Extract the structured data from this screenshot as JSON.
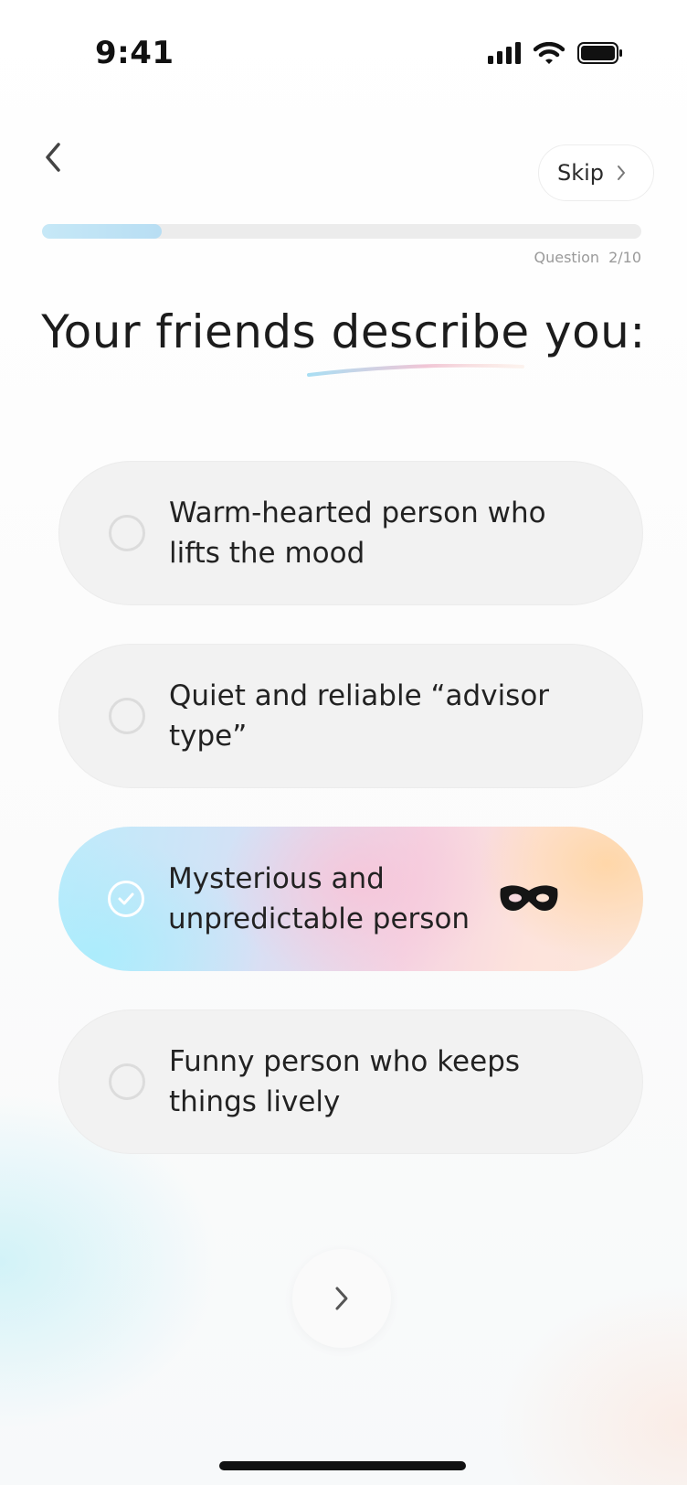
{
  "status_bar": {
    "time": "9:41",
    "icons": [
      "signal-icon",
      "wifi-icon",
      "battery-icon"
    ]
  },
  "header": {
    "back_icon": "chevron-left-icon",
    "skip_label": "Skip",
    "skip_icon": "chevron-right-icon"
  },
  "progress": {
    "label": "Question",
    "count": "2/10",
    "fraction": 0.2
  },
  "title": "Your friends describe you:",
  "options": [
    {
      "label": "Warm-hearted person who lifts the mood",
      "selected": false
    },
    {
      "label": "Quiet and reliable “advisor type”",
      "selected": false
    },
    {
      "label": "Mysterious and unpredictable person",
      "selected": true,
      "icon": "mask-icon"
    },
    {
      "label": "Funny person who keeps things lively",
      "selected": false
    }
  ],
  "next_icon": "chevron-right-icon",
  "colors": {
    "selected_gradient": [
      "#bdebfb",
      "#f5d3e2",
      "#fce7da"
    ],
    "progress_fill": "#c6e8f7"
  }
}
